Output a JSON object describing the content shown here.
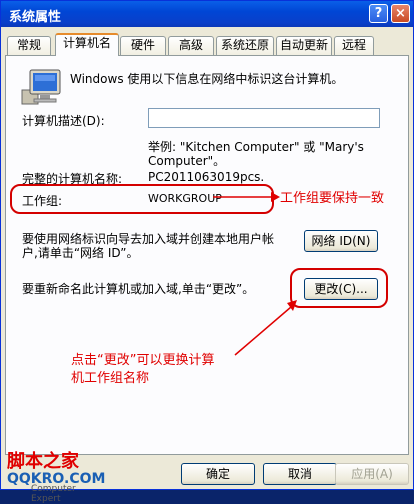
{
  "window": {
    "title": "系统属性",
    "help_glyph": "?",
    "close_glyph": "×"
  },
  "tabs": [
    {
      "label": "常规"
    },
    {
      "label": "计算机名"
    },
    {
      "label": "硬件"
    },
    {
      "label": "高级"
    },
    {
      "label": "系统还原"
    },
    {
      "label": "自动更新"
    },
    {
      "label": "远程"
    }
  ],
  "active_tab": "计算机名",
  "panel": {
    "intro": "Windows 使用以下信息在网络中标识这台计算机。",
    "desc_label": "计算机描述(D):",
    "desc_value": "",
    "example_line1": "举例: \"Kitchen Computer\" 或 \"Mary's",
    "example_line2": "Computer\"。",
    "fullname_label": "完整的计算机名称:",
    "fullname_value": "PC2011063019pcs.",
    "workgroup_label": "工作组:",
    "workgroup_value": "WORKGROUP",
    "wizard_text_1": "要使用网络标识向导去加入域并创建本地用户帐",
    "wizard_text_2": "户,请单击“网络 ID”。",
    "network_id_button": "网络 ID(N)",
    "rename_text": "要重新命名此计算机或加入域,单击“更改”。",
    "change_button": "更改(C)..."
  },
  "annotations": {
    "keep_consistent": "工作组要保持一致",
    "click_change_1": "点击“更改”可以更换计算",
    "click_change_2": "机工作组名称",
    "annot_color": "#e00000"
  },
  "watermark": {
    "line1": "脚本之家",
    "line2": "QQKRO.COM",
    "line3": "Computer Expert"
  },
  "footer": {
    "ok": "确定",
    "cancel": "取消",
    "apply": "应用(A)"
  }
}
